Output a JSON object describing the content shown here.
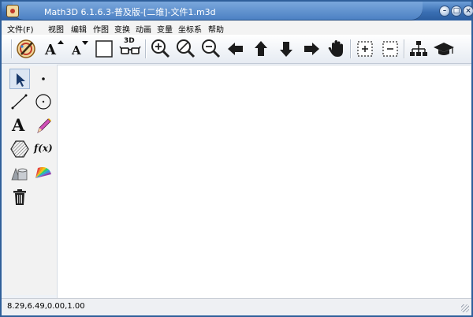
{
  "window": {
    "title": "Math3D 6.1.6.3-普及版-[二维]-文件1.m3d"
  },
  "menu": [
    "文件(F)",
    "视图",
    "编辑",
    "作图",
    "变换",
    "动画",
    "变量",
    "坐标系",
    "帮助"
  ],
  "toolbar": {
    "font_up_label": "A",
    "font_down_label": "A",
    "mode_3d_label": "3D"
  },
  "toolpanel": {
    "text_tool_label": "A",
    "function_tool_label": "f(x)"
  },
  "status": {
    "coords": "8.29,6.49,0.00,1.00"
  },
  "colors": {
    "titlebar": "#3a6fb3",
    "arrow_blue": "#1a3a6b"
  }
}
